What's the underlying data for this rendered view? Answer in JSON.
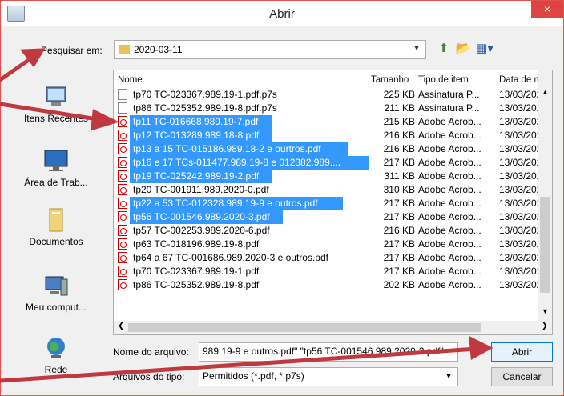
{
  "window": {
    "title": "Abrir",
    "close": "×"
  },
  "lookin": {
    "label": "Pesquisar em:",
    "value": "2020-03-11"
  },
  "sidebar": [
    {
      "label": "Itens Recentes"
    },
    {
      "label": "Área de Trab..."
    },
    {
      "label": "Documentos"
    },
    {
      "label": "Meu comput..."
    },
    {
      "label": "Rede"
    }
  ],
  "columns": [
    "Nome",
    "Tamanho",
    "Tipo de item",
    "Data de mo"
  ],
  "files": [
    {
      "name": "tp70 TC-023367.989.19-1.pdf.p7s",
      "size": "225 KB",
      "type": "Assinatura P...",
      "date": "13/03/202(",
      "icon": "p7s",
      "selected": false
    },
    {
      "name": "tp86 TC-025352.989.19-8.pdf.p7s",
      "size": "211 KB",
      "type": "Assinatura P...",
      "date": "13/03/202(",
      "icon": "p7s",
      "selected": false
    },
    {
      "name": "tp11 TC-016668.989.19-7.pdf",
      "size": "215 KB",
      "type": "Adobe Acrob...",
      "date": "13/03/202(",
      "icon": "pdf",
      "selected": true
    },
    {
      "name": "tp12 TC-013289.989.18-8.pdf",
      "size": "216 KB",
      "type": "Adobe Acrob...",
      "date": "13/03/202(",
      "icon": "pdf",
      "selected": true
    },
    {
      "name": "tp13 a 15 TC-015186.989.18-2 e ourtros.pdf",
      "size": "216 KB",
      "type": "Adobe Acrob...",
      "date": "13/03/202(",
      "icon": "pdf",
      "selected": true
    },
    {
      "name": "tp16 e 17 TCs-011477.989.19-8 e 012382.989....",
      "size": "217 KB",
      "type": "Adobe Acrob...",
      "date": "13/03/202(",
      "icon": "pdf",
      "selected": true
    },
    {
      "name": "tp19 TC-025242.989.19-2.pdf",
      "size": "311 KB",
      "type": "Adobe Acrob...",
      "date": "13/03/202(",
      "icon": "pdf",
      "selected": true
    },
    {
      "name": "tp20 TC-001911.989.2020-0.pdf",
      "size": "310 KB",
      "type": "Adobe Acrob...",
      "date": "13/03/202(",
      "icon": "pdf",
      "selected": false
    },
    {
      "name": "tp22 a 53 TC-012328.989.19-9 e outros.pdf",
      "size": "217 KB",
      "type": "Adobe Acrob...",
      "date": "13/03/202(",
      "icon": "pdf",
      "selected": true
    },
    {
      "name": "tp56 TC-001546.989.2020-3.pdf",
      "size": "217 KB",
      "type": "Adobe Acrob...",
      "date": "13/03/202(",
      "icon": "pdf",
      "selected": true
    },
    {
      "name": "tp57 TC-002253.989.2020-6.pdf",
      "size": "216 KB",
      "type": "Adobe Acrob...",
      "date": "13/03/202(",
      "icon": "pdf",
      "selected": false
    },
    {
      "name": "tp63 TC-018196.989.19-8.pdf",
      "size": "217 KB",
      "type": "Adobe Acrob...",
      "date": "13/03/202(",
      "icon": "pdf",
      "selected": false
    },
    {
      "name": "tp64 a 67 TC-001686.989.2020-3 e outros.pdf",
      "size": "217 KB",
      "type": "Adobe Acrob...",
      "date": "13/03/202(",
      "icon": "pdf",
      "selected": false
    },
    {
      "name": "tp70 TC-023367.989.19-1.pdf",
      "size": "217 KB",
      "type": "Adobe Acrob...",
      "date": "13/03/202(",
      "icon": "pdf",
      "selected": false
    },
    {
      "name": "tp86 TC-025352.989.19-8.pdf",
      "size": "202 KB",
      "type": "Adobe Acrob...",
      "date": "13/03/202(",
      "icon": "pdf",
      "selected": false
    }
  ],
  "filename": {
    "label": "Nome do arquivo:",
    "value": "989.19-9 e outros.pdf\" \"tp56 TC-001546.989.2020-3.pdf\""
  },
  "filetype": {
    "label": "Arquivos do tipo:",
    "value": "Permitidos (*.pdf, *.p7s)"
  },
  "buttons": {
    "open": "Abrir",
    "cancel": "Cancelar"
  },
  "colors": {
    "selection": "#3399ff",
    "arrows": "#c0393f",
    "close": "#e04343"
  }
}
